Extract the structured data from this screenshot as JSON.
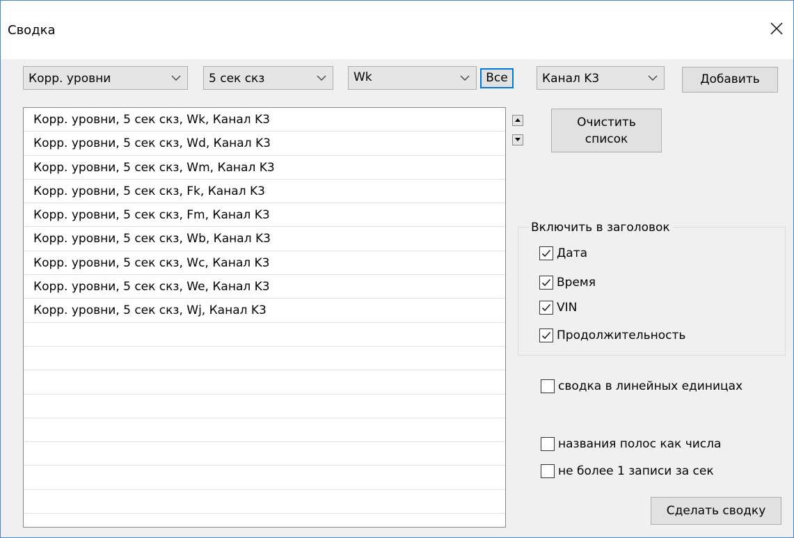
{
  "window": {
    "title": "Сводка",
    "accent": "#0078d7"
  },
  "toolbar": {
    "combo_levels": "Корр. уровни",
    "combo_period": "5 сек скз",
    "combo_weight": "Wk",
    "all_button": "Все",
    "combo_channel": "Канал K3",
    "add_button": "Добавить"
  },
  "list": {
    "items": [
      "Корр. уровни, 5 сек скз, Wk, Канал K3",
      "Корр. уровни, 5 сек скз, Wd, Канал K3",
      "Корр. уровни, 5 сек скз, Wm, Канал K3",
      "Корр. уровни, 5 сек скз, Fk, Канал K3",
      "Корр. уровни, 5 сек скз, Fm, Канал K3",
      "Корр. уровни, 5 сек скз, Wb, Канал K3",
      "Корр. уровни, 5 сек скз, Wc, Канал K3",
      "Корр. уровни, 5 сек скз, We, Канал K3",
      "Корр. уровни, 5 сек скз, Wj, Канал K3",
      "",
      "",
      "",
      "",
      "",
      "",
      "",
      "",
      ""
    ]
  },
  "clear": {
    "line1": "Очистить",
    "line2": "список"
  },
  "header_group": {
    "label": "Включить в заголовок",
    "date": "Дата",
    "time": "Время",
    "vin": "VIN",
    "duration": "Продолжительность"
  },
  "options": {
    "linear_units": "сводка в линейных единицах",
    "band_names": "названия полос как числа",
    "one_per_sec": "не более 1 записи за сек"
  },
  "make_button": "Сделать сводку"
}
